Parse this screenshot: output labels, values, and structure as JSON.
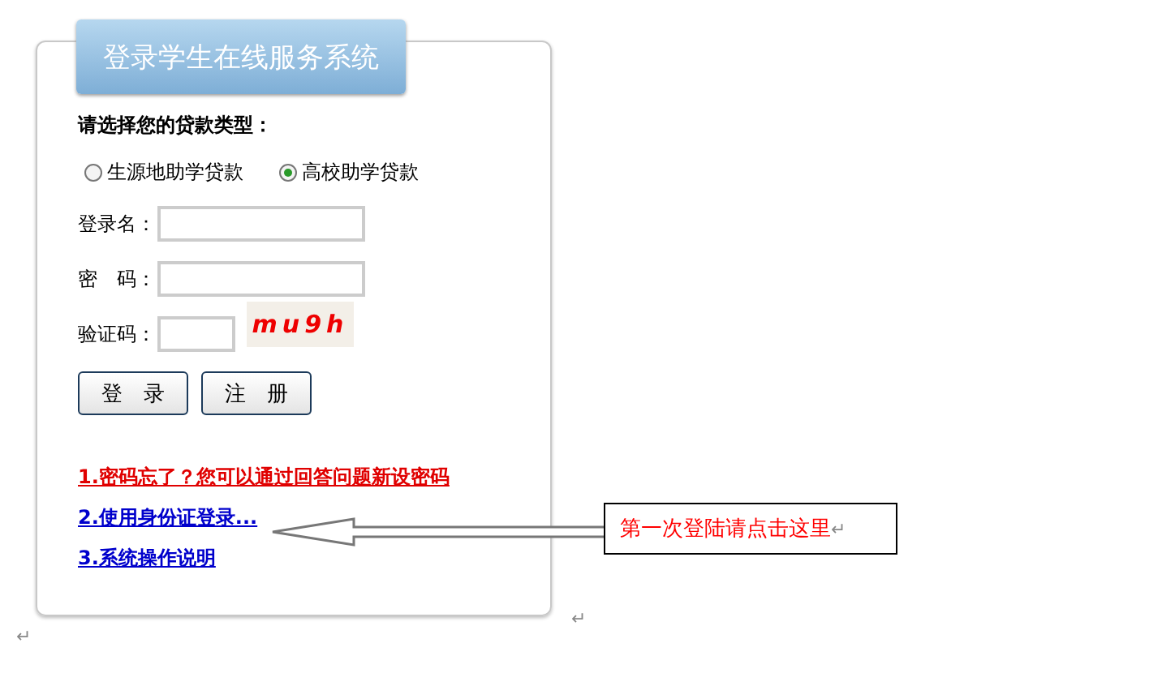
{
  "title": "登录学生在线服务系统",
  "loan_type": {
    "label": "请选择您的贷款类型：",
    "options": [
      {
        "label": "生源地助学贷款",
        "selected": false
      },
      {
        "label": "高校助学贷款",
        "selected": true
      }
    ]
  },
  "fields": [
    {
      "label": "登录名：",
      "kind": "text"
    },
    {
      "label": "密　码：",
      "kind": "text"
    },
    {
      "label": "验证码：",
      "kind": "captcha",
      "captcha": "mu9h"
    }
  ],
  "buttons": [
    "登　录",
    "注　册"
  ],
  "links": [
    {
      "text": "1.密码忘了？您可以通过回答问题新设密码",
      "color": "#e00000"
    },
    {
      "text": "2.使用身份证登录...",
      "color": "#0000cc"
    },
    {
      "text": "3.系统操作说明",
      "color": "#0000cc"
    }
  ],
  "callout": {
    "text": "第一次登陆请点击这里",
    "mark": "↵"
  },
  "paragraph_marks": [
    "↵",
    "↵"
  ]
}
